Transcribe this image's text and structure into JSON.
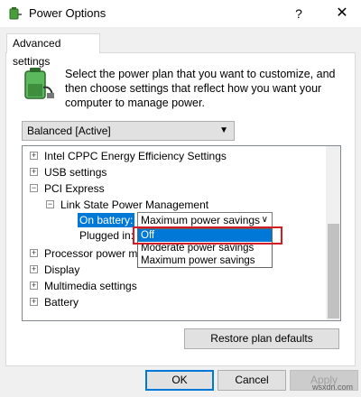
{
  "window": {
    "title": "Power Options",
    "help_glyph": "?",
    "close_glyph": "✕",
    "icon": "power-options-icon"
  },
  "tab": {
    "label": "Advanced settings"
  },
  "intro": {
    "icon": "battery-plug-icon",
    "text": "Select the power plan that you want to customize, and then choose settings that reflect how you want your computer to manage power."
  },
  "plan_select": {
    "value": "Balanced [Active]"
  },
  "tree": {
    "items": [
      {
        "label": "Intel CPPC Energy Efficiency Settings",
        "expander": "+"
      },
      {
        "label": "USB settings",
        "expander": "+"
      },
      {
        "label": "PCI Express",
        "expander": "−"
      },
      {
        "label": "Link State Power Management",
        "expander": "−"
      },
      {
        "label": "Processor power m",
        "expander": "+"
      },
      {
        "label": "Display",
        "expander": "+"
      },
      {
        "label": "Multimedia settings",
        "expander": "+"
      },
      {
        "label": "Battery",
        "expander": "+"
      }
    ],
    "on_battery_label": "On battery:",
    "on_battery_value": "Maximum power savings",
    "plugged_in_label": "Plugged in:",
    "dropdown_options": [
      "Off",
      "Moderate power savings",
      "Maximum power savings"
    ],
    "selected_option": "Off"
  },
  "buttons": {
    "restore": "Restore plan defaults",
    "ok": "OK",
    "cancel": "Cancel",
    "apply": "Apply"
  },
  "watermark": "wsxdn.com",
  "colors": {
    "accent": "#0078d7",
    "highlight_border": "#d11b25"
  }
}
